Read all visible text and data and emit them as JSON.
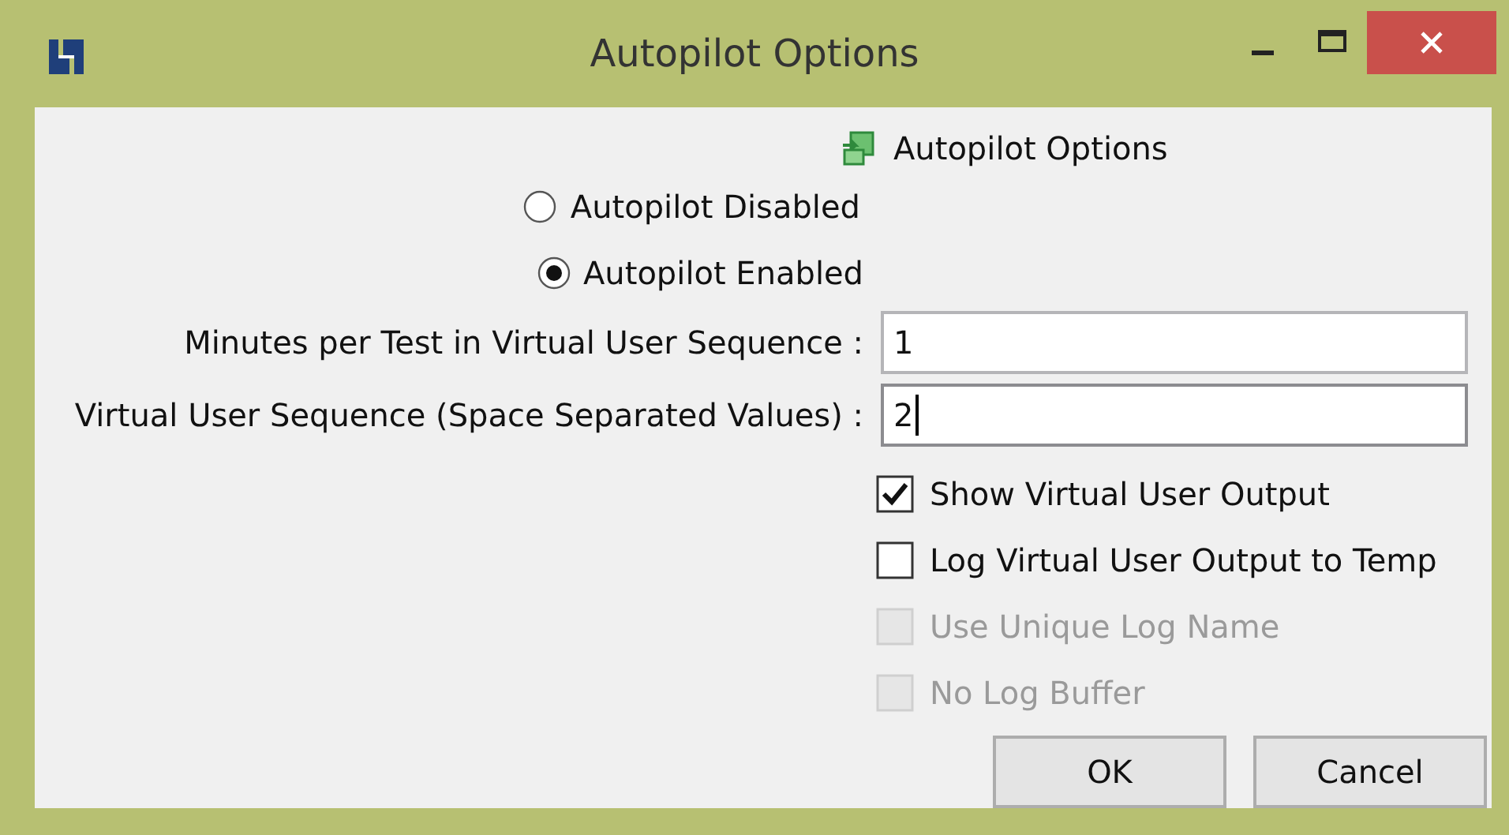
{
  "window": {
    "title": "Autopilot Options"
  },
  "header": {
    "title": "Autopilot Options"
  },
  "radios": [
    {
      "label": "Autopilot Disabled",
      "selected": false
    },
    {
      "label": "Autopilot Enabled",
      "selected": true
    }
  ],
  "fields": [
    {
      "label": "Minutes per Test in Virtual User Sequence :",
      "value": "1",
      "focused": false
    },
    {
      "label": "Virtual User Sequence (Space Separated Values) :",
      "value": "2",
      "focused": true
    }
  ],
  "checkboxes": [
    {
      "label": "Show Virtual User Output",
      "checked": true,
      "disabled": false
    },
    {
      "label": "Log Virtual User Output to Temp",
      "checked": false,
      "disabled": false
    },
    {
      "label": "Use Unique Log Name",
      "checked": false,
      "disabled": true
    },
    {
      "label": "No Log Buffer",
      "checked": false,
      "disabled": true
    }
  ],
  "buttons": [
    {
      "label": "OK"
    },
    {
      "label": "Cancel"
    }
  ]
}
